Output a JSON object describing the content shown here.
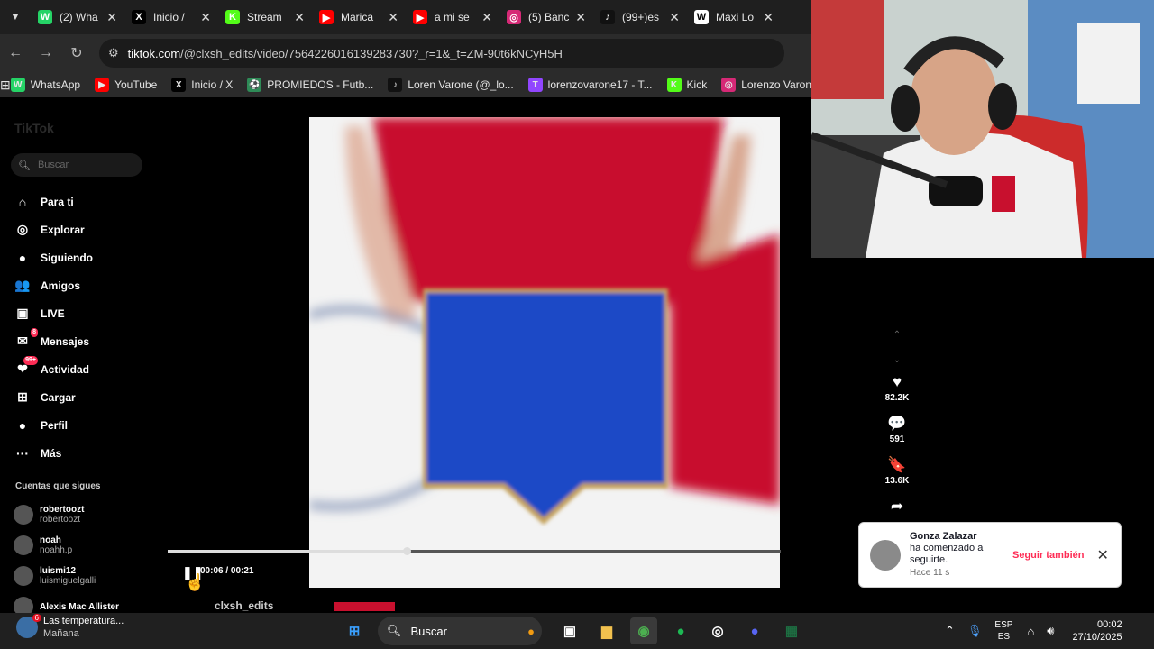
{
  "browser": {
    "tabs": [
      {
        "label": "(2) Wha",
        "icon": "whatsapp-icon",
        "color": "#25d366",
        "glyph": "W"
      },
      {
        "label": "Inicio /",
        "icon": "x-icon",
        "color": "#000000",
        "glyph": "X"
      },
      {
        "label": "Stream",
        "icon": "kick-icon",
        "color": "#53fc18",
        "glyph": "K"
      },
      {
        "label": "Marica",
        "icon": "youtube-icon",
        "color": "#ff0000",
        "glyph": "▶"
      },
      {
        "label": "a mi se",
        "icon": "youtube-icon",
        "color": "#ff0000",
        "glyph": "▶"
      },
      {
        "label": "(5) Banc",
        "icon": "instagram-icon",
        "color": "#d62976",
        "glyph": "◎"
      },
      {
        "label": "(99+)es",
        "icon": "tiktok-icon",
        "color": "#111111",
        "glyph": "♪"
      },
      {
        "label": "Maxi Lo",
        "icon": "wikipedia-icon",
        "color": "#ffffff",
        "glyph": "W"
      }
    ],
    "url_host": "tiktok.com",
    "url_path": "/@clxsh_edits/video/7564226016139283730?_r=1&_t=ZM-90t6kNCyH5H",
    "bookmarks": [
      {
        "label": "WhatsApp",
        "icon": "whatsapp-icon",
        "color": "#25d366",
        "glyph": "W"
      },
      {
        "label": "YouTube",
        "icon": "youtube-icon",
        "color": "#ff0000",
        "glyph": "▶"
      },
      {
        "label": "Inicio / X",
        "icon": "x-icon",
        "color": "#000000",
        "glyph": "X"
      },
      {
        "label": "PROMIEDOS - Futb...",
        "icon": "promiedos-icon",
        "color": "#2e8b57",
        "glyph": "⚽"
      },
      {
        "label": "Loren Varone (@_lo...",
        "icon": "tiktok-icon",
        "color": "#111111",
        "glyph": "♪"
      },
      {
        "label": "lorenzovarone17 - T...",
        "icon": "twitch-icon",
        "color": "#9146ff",
        "glyph": "T"
      },
      {
        "label": "Kick",
        "icon": "kick-icon",
        "color": "#53fc18",
        "glyph": "K"
      },
      {
        "label": "Lorenzo Varone (I...",
        "icon": "instagram-icon",
        "color": "#d62976",
        "glyph": "◎"
      }
    ]
  },
  "tiktok": {
    "logo": "TikTok",
    "search_placeholder": "Buscar",
    "nav": [
      {
        "label": "Para ti",
        "icon": "home-icon",
        "glyph": "⌂"
      },
      {
        "label": "Explorar",
        "icon": "compass-icon",
        "glyph": "◎"
      },
      {
        "label": "Siguiendo",
        "icon": "following-avatar-icon",
        "glyph": "●"
      },
      {
        "label": "Amigos",
        "icon": "friends-icon",
        "glyph": "👥"
      },
      {
        "label": "LIVE",
        "icon": "live-icon",
        "glyph": "▣"
      },
      {
        "label": "Mensajes",
        "icon": "messages-icon",
        "glyph": "✉",
        "badge": "8"
      },
      {
        "label": "Actividad",
        "icon": "activity-icon",
        "glyph": "❤",
        "badge": "99+"
      },
      {
        "label": "Cargar",
        "icon": "upload-icon",
        "glyph": "⊞"
      },
      {
        "label": "Perfil",
        "icon": "profile-icon",
        "glyph": "●"
      },
      {
        "label": "Más",
        "icon": "more-icon",
        "glyph": "···"
      }
    ],
    "following_title": "Cuentas que sigues",
    "following": [
      {
        "name": "robertoozt",
        "handle": "robertoozt"
      },
      {
        "name": "noah",
        "handle": "noahh.p"
      },
      {
        "name": "luismi12",
        "handle": "luismiguelgalli"
      },
      {
        "name": "Alexis Mac Allister",
        "handle": ""
      }
    ],
    "player": {
      "time": "00:06 / 00:21",
      "progress": 0.39,
      "author": "clxsh_edits"
    },
    "actions": [
      {
        "icon": "heart-icon",
        "glyph": "♥",
        "count": "82.2K"
      },
      {
        "icon": "comment-icon",
        "glyph": "💬",
        "count": "591"
      },
      {
        "icon": "bookmark-icon",
        "glyph": "🔖",
        "count": "13.6K"
      },
      {
        "icon": "share-icon",
        "glyph": "➦",
        "count": ""
      }
    ],
    "toast": {
      "name": "Gonza Zalazar",
      "message": "ha comenzado a seguirte.",
      "time": "Hace 11 s",
      "follow_back": "Seguir también"
    }
  },
  "taskbar": {
    "weather_title": "Las temperatura...",
    "weather_sub": "Mañana",
    "weather_badge": "6",
    "search": "Buscar",
    "lang1": "ESP",
    "lang2": "ES",
    "time": "00:02",
    "date": "27/10/2025"
  }
}
